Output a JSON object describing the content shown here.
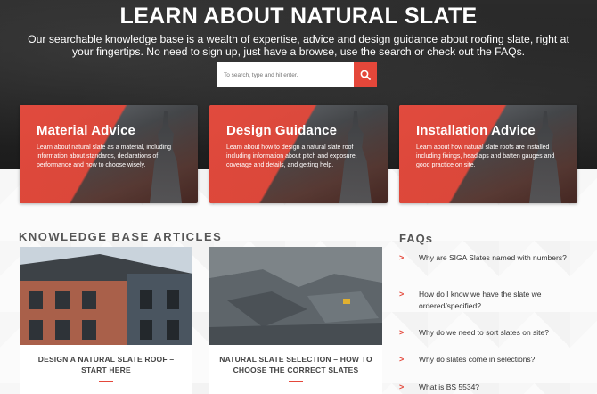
{
  "hero": {
    "title": "LEARN ABOUT NATURAL SLATE",
    "subtitle": "Our searchable knowledge base is a wealth of expertise, advice and design guidance about roofing slate, right at your fingertips. No need to sign up, just have a browse, use the search or check out the FAQs.",
    "search_placeholder": "To search, type and hit enter.",
    "search_icon": "search-icon"
  },
  "cards": [
    {
      "title": "Material Advice",
      "text": "Learn about natural slate as a material, including information about standards, declarations of performance and how to choose wisely."
    },
    {
      "title": "Design Guidance",
      "text": "Learn about how to design a natural slate roof including information about pitch and exposure, coverage and details, and getting help."
    },
    {
      "title": "Installation Advice",
      "text": "Learn about how natural slate roofs are installed including fixings, headlaps and batten gauges and good practice on site."
    }
  ],
  "knowledge_base": {
    "heading": "KNOWLEDGE BASE ARTICLES",
    "articles": [
      {
        "title": "DESIGN A NATURAL SLATE ROOF – START HERE"
      },
      {
        "title": "NATURAL SLATE SELECTION – HOW TO CHOOSE THE CORRECT SLATES"
      }
    ]
  },
  "faqs": {
    "heading": "FAQs",
    "chevron": ">",
    "items": [
      "Why are SIGA Slates named with numbers?",
      "How do I know we have the slate we ordered/specified?",
      "Why do we need to sort slates on site?",
      "Why do slates come in selections?",
      "What is BS 5534?"
    ]
  },
  "colors": {
    "accent": "#e4473a",
    "hero_bg": "#222222",
    "heading_text": "#555555"
  }
}
